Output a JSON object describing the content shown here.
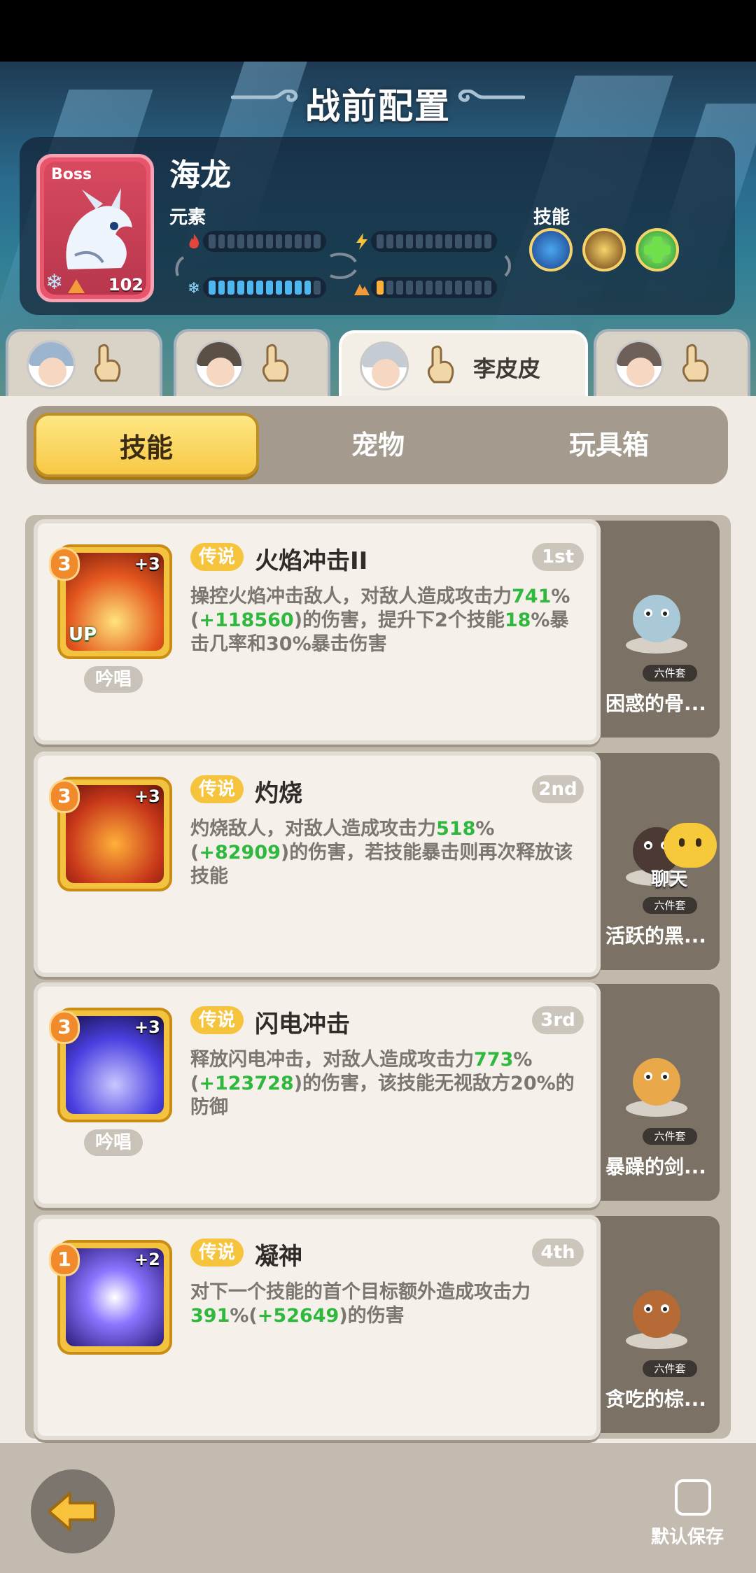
{
  "header": {
    "title": "战前配置"
  },
  "boss": {
    "tag": "Boss",
    "name": "海龙",
    "level": "102",
    "element_label": "元素",
    "skill_label": "技能",
    "bars": [
      {
        "icon": "fire-icon",
        "filled": 0,
        "total": 12
      },
      {
        "icon": "lightning-icon",
        "filled": 0,
        "total": 12
      },
      {
        "icon": "ice-icon",
        "filled": 11,
        "total": 12
      },
      {
        "icon": "earth-icon",
        "filled": 1,
        "total": 12
      }
    ],
    "skills": [
      "water-swirl-skill-icon",
      "gold-spike-skill-icon",
      "green-plus-skill-icon"
    ]
  },
  "heroes": [
    {
      "name": ""
    },
    {
      "name": ""
    },
    {
      "name": "李皮皮",
      "active": true
    },
    {
      "name": ""
    }
  ],
  "tabs": [
    "技能",
    "宠物",
    "玩具箱"
  ],
  "skills": [
    {
      "level": "3",
      "plus": "+3",
      "up": "UP",
      "chant": "吟唱",
      "rarity": "传说",
      "name": "火焰冲击II",
      "order": "1st",
      "desc": [
        {
          "t": "操控火焰冲击敌人，对敌人造成攻击力"
        },
        {
          "t": "741",
          "g": true
        },
        {
          "t": "%("
        },
        {
          "t": "+118560",
          "g": true
        },
        {
          "t": ")的伤害，提升下2个技能"
        },
        {
          "t": "18",
          "g": true
        },
        {
          "t": "%暴击几率和30%暴击伤害"
        }
      ],
      "pet": {
        "set": "六件套",
        "name": "困惑的骨..."
      }
    },
    {
      "level": "3",
      "plus": "+3",
      "chant": "",
      "rarity": "传说",
      "name": "灼烧",
      "order": "2nd",
      "desc": [
        {
          "t": "灼烧敌人，对敌人造成攻击力"
        },
        {
          "t": "518",
          "g": true
        },
        {
          "t": "%("
        },
        {
          "t": "+82909",
          "g": true
        },
        {
          "t": ")的伤害，若技能暴击则再次释放该技能"
        }
      ],
      "pet": {
        "set": "六件套",
        "name": "活跃的黑...",
        "chat": "聊天"
      }
    },
    {
      "level": "3",
      "plus": "+3",
      "chant": "吟唱",
      "rarity": "传说",
      "name": "闪电冲击",
      "order": "3rd",
      "desc": [
        {
          "t": "释放闪电冲击，对敌人造成攻击力"
        },
        {
          "t": "773",
          "g": true
        },
        {
          "t": "%("
        },
        {
          "t": "+123728",
          "g": true
        },
        {
          "t": ")的伤害，该技能无视敌方20%的防御"
        }
      ],
      "pet": {
        "set": "六件套",
        "name": "暴躁的剑..."
      }
    },
    {
      "level": "1",
      "plus": "+2",
      "chant": "",
      "rarity": "传说",
      "name": "凝神",
      "order": "4th",
      "desc": [
        {
          "t": "对下一个技能的首个目标额外造成攻击力"
        },
        {
          "t": "391",
          "g": true
        },
        {
          "t": "%("
        },
        {
          "t": "+52649",
          "g": true
        },
        {
          "t": ")的伤害"
        }
      ],
      "pet": {
        "set": "六件套",
        "name": "贪吃的棕..."
      }
    }
  ],
  "footer": {
    "save_label": "默认保存"
  }
}
